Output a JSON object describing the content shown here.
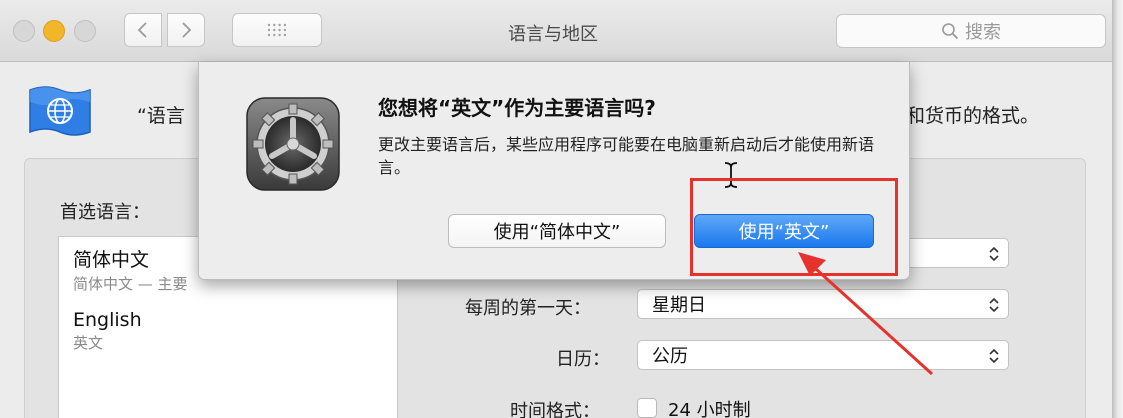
{
  "window": {
    "title": "语言与地区",
    "search_placeholder": "搜索"
  },
  "header": {
    "description_left": "“语言",
    "description_right": "和货币的格式。"
  },
  "preferred_languages": {
    "label": "首选语言：",
    "items": [
      {
        "name": "简体中文",
        "detail": "简体中文 — 主要"
      },
      {
        "name": "English",
        "detail": "英文"
      }
    ]
  },
  "settings": {
    "first_day_label": "每周的第一天：",
    "first_day_value": "星期日",
    "calendar_label": "日历：",
    "calendar_value": "公历",
    "time_format_label": "时间格式：",
    "time_format_option": "24 小时制",
    "time_format_checked": false
  },
  "alert": {
    "title": "您想将“英文”作为主要语言吗?",
    "body": "更改主要语言后，某些应用程序可能要在电脑重新启动后才能使用新语言。",
    "secondary_button": "使用“简体中文”",
    "primary_button": "使用“英文”"
  },
  "colors": {
    "accent_blue": "#1a78ee",
    "annotation_red": "#e5322d",
    "minimize_yellow": "#f3b62a"
  }
}
